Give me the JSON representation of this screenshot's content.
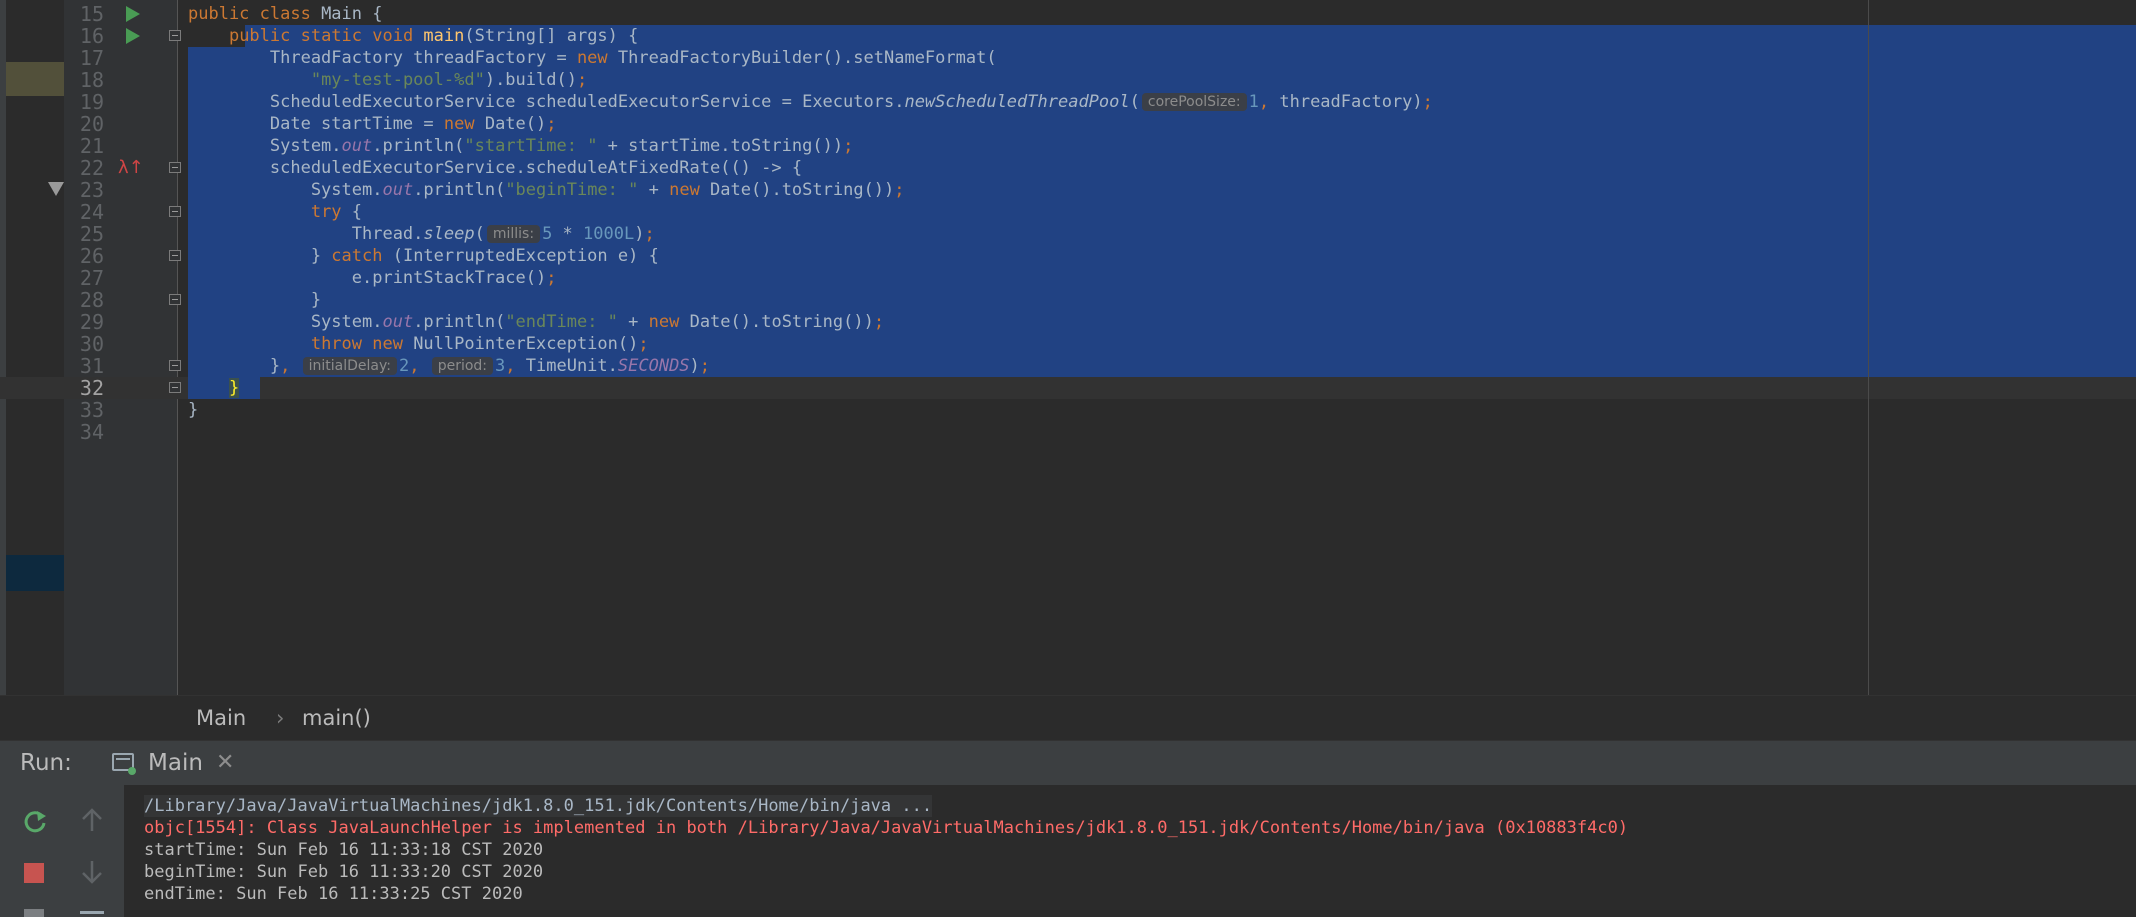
{
  "editor": {
    "lines": [
      {
        "num": "15",
        "current": false,
        "run": true,
        "fold": false,
        "override": false,
        "selection": null,
        "tokens": [
          {
            "t": "public class ",
            "c": "kw"
          },
          {
            "t": "Main {"
          }
        ]
      },
      {
        "num": "16",
        "current": false,
        "run": true,
        "fold": true,
        "override": false,
        "selection": "from-indent",
        "tokens": [
          {
            "t": "    "
          },
          {
            "t": "public static void ",
            "c": "kw"
          },
          {
            "t": "main",
            "c": "fn"
          },
          {
            "t": "(String[] args) {"
          }
        ]
      },
      {
        "num": "17",
        "current": false,
        "run": false,
        "fold": false,
        "override": false,
        "selection": "full",
        "tokens": [
          {
            "t": "        ThreadFactory threadFactory = "
          },
          {
            "t": "new ",
            "c": "kw"
          },
          {
            "t": "ThreadFactoryBuilder().setNameFormat("
          }
        ]
      },
      {
        "num": "18",
        "current": false,
        "run": false,
        "fold": false,
        "override": false,
        "selection": "full",
        "tokens": [
          {
            "t": "            "
          },
          {
            "t": "\"my-test-pool-%d\"",
            "c": "str"
          },
          {
            "t": ").build()"
          },
          {
            "t": ";",
            "c": "kw"
          }
        ]
      },
      {
        "num": "19",
        "current": false,
        "run": false,
        "fold": false,
        "override": false,
        "selection": "full",
        "tokens": [
          {
            "t": "        ScheduledExecutorService scheduledExecutorService = Executors."
          },
          {
            "t": "newScheduledThreadPool",
            "c": "ital"
          },
          {
            "t": "("
          },
          {
            "t": "corePoolSize:",
            "c": "hint"
          },
          {
            "t": "1",
            "c": "num"
          },
          {
            "t": ", ",
            "c": "kw"
          },
          {
            "t": "threadFactory)"
          },
          {
            "t": ";",
            "c": "kw"
          }
        ]
      },
      {
        "num": "20",
        "current": false,
        "run": false,
        "fold": false,
        "override": false,
        "selection": "full",
        "tokens": [
          {
            "t": "        Date startTime = "
          },
          {
            "t": "new ",
            "c": "kw"
          },
          {
            "t": "Date()"
          },
          {
            "t": ";",
            "c": "kw"
          }
        ]
      },
      {
        "num": "21",
        "current": false,
        "run": false,
        "fold": false,
        "override": false,
        "selection": "full",
        "tokens": [
          {
            "t": "        System."
          },
          {
            "t": "out",
            "c": "field"
          },
          {
            "t": ".println("
          },
          {
            "t": "\"startTime: \"",
            "c": "str"
          },
          {
            "t": " + startTime.toString())"
          },
          {
            "t": ";",
            "c": "kw"
          }
        ]
      },
      {
        "num": "22",
        "current": false,
        "run": false,
        "fold": true,
        "override": true,
        "selection": "full",
        "tokens": [
          {
            "t": "        scheduledExecutorService.scheduleAtFixedRate(() -> {"
          }
        ]
      },
      {
        "num": "23",
        "current": false,
        "run": false,
        "fold": false,
        "override": false,
        "selection": "full",
        "tokens": [
          {
            "t": "            System."
          },
          {
            "t": "out",
            "c": "field"
          },
          {
            "t": ".println("
          },
          {
            "t": "\"beginTime: \"",
            "c": "str"
          },
          {
            "t": " + "
          },
          {
            "t": "new ",
            "c": "kw"
          },
          {
            "t": "Date().toString())"
          },
          {
            "t": ";",
            "c": "kw"
          }
        ]
      },
      {
        "num": "24",
        "current": false,
        "run": false,
        "fold": true,
        "override": false,
        "selection": "full",
        "tokens": [
          {
            "t": "            "
          },
          {
            "t": "try ",
            "c": "kw"
          },
          {
            "t": "{"
          }
        ]
      },
      {
        "num": "25",
        "current": false,
        "run": false,
        "fold": false,
        "override": false,
        "selection": "full",
        "tokens": [
          {
            "t": "                Thread."
          },
          {
            "t": "sleep",
            "c": "ital"
          },
          {
            "t": "("
          },
          {
            "t": "millis:",
            "c": "hint"
          },
          {
            "t": "5 ",
            "c": "num"
          },
          {
            "t": "* "
          },
          {
            "t": "1000L",
            "c": "num"
          },
          {
            "t": ")"
          },
          {
            "t": ";",
            "c": "kw"
          }
        ]
      },
      {
        "num": "26",
        "current": false,
        "run": false,
        "fold": true,
        "override": false,
        "selection": "full",
        "tokens": [
          {
            "t": "            } "
          },
          {
            "t": "catch ",
            "c": "kw"
          },
          {
            "t": "(InterruptedException e) {"
          }
        ]
      },
      {
        "num": "27",
        "current": false,
        "run": false,
        "fold": false,
        "override": false,
        "selection": "full",
        "tokens": [
          {
            "t": "                e.printStackTrace()"
          },
          {
            "t": ";",
            "c": "kw"
          }
        ]
      },
      {
        "num": "28",
        "current": false,
        "run": false,
        "fold": true,
        "override": false,
        "selection": "full",
        "tokens": [
          {
            "t": "            }"
          }
        ]
      },
      {
        "num": "29",
        "current": false,
        "run": false,
        "fold": false,
        "override": false,
        "selection": "full",
        "tokens": [
          {
            "t": "            System."
          },
          {
            "t": "out",
            "c": "field"
          },
          {
            "t": ".println("
          },
          {
            "t": "\"endTime: \"",
            "c": "str"
          },
          {
            "t": " + "
          },
          {
            "t": "new ",
            "c": "kw"
          },
          {
            "t": "Date().toString())"
          },
          {
            "t": ";",
            "c": "kw"
          }
        ]
      },
      {
        "num": "30",
        "current": false,
        "run": false,
        "fold": false,
        "override": false,
        "selection": "full",
        "tokens": [
          {
            "t": "            "
          },
          {
            "t": "throw new ",
            "c": "kw"
          },
          {
            "t": "NullPointerException()"
          },
          {
            "t": ";",
            "c": "kw"
          }
        ]
      },
      {
        "num": "31",
        "current": false,
        "run": false,
        "fold": true,
        "override": false,
        "selection": "full",
        "tokens": [
          {
            "t": "        }"
          },
          {
            "t": ", ",
            "c": "kw"
          },
          {
            "t": "initialDelay:",
            "c": "hint"
          },
          {
            "t": "2",
            "c": "num"
          },
          {
            "t": ", ",
            "c": "kw"
          },
          {
            "t": "period:",
            "c": "hint"
          },
          {
            "t": "3",
            "c": "num"
          },
          {
            "t": ", ",
            "c": "kw"
          },
          {
            "t": "TimeUnit."
          },
          {
            "t": "SECONDS",
            "c": "field"
          },
          {
            "t": ")"
          },
          {
            "t": ";",
            "c": "kw"
          }
        ]
      },
      {
        "num": "32",
        "current": true,
        "run": false,
        "fold": true,
        "override": false,
        "selection": "partial",
        "tokens": [
          {
            "t": "    "
          },
          {
            "t": "}",
            "c": "brace"
          }
        ]
      },
      {
        "num": "33",
        "current": false,
        "run": false,
        "fold": false,
        "override": false,
        "selection": null,
        "tokens": [
          {
            "t": "}"
          }
        ]
      },
      {
        "num": "34",
        "current": false,
        "run": false,
        "fold": false,
        "override": false,
        "selection": null,
        "tokens": []
      }
    ]
  },
  "breadcrumbs": {
    "class_name": "Main",
    "separator": "›",
    "method": "main()"
  },
  "run_panel": {
    "label": "Run:",
    "tab_label": "Main",
    "tab_close": "✕",
    "console": [
      {
        "text": "/Library/Java/JavaVirtualMachines/jdk1.8.0_151.jdk/Contents/Home/bin/java ...",
        "kind": "cmd"
      },
      {
        "text": "objc[1554]: Class JavaLaunchHelper is implemented in both /Library/Java/JavaVirtualMachines/jdk1.8.0_151.jdk/Contents/Home/bin/java (0x10883f4c0)",
        "kind": "err"
      },
      {
        "text": "startTime: Sun Feb 16 11:33:18 CST 2020",
        "kind": "out"
      },
      {
        "text": "beginTime: Sun Feb 16 11:33:20 CST 2020",
        "kind": "out"
      },
      {
        "text": "endTime: Sun Feb 16 11:33:25 CST 2020",
        "kind": "out"
      }
    ],
    "toolbar_icons": [
      "rerun-icon",
      "up-arrow-icon",
      "stop-icon",
      "down-arrow-icon",
      "settings-icon"
    ]
  },
  "colors": {
    "editor_bg": "#2b2b2b",
    "selection": "#214283",
    "keyword": "#cc7832",
    "string": "#6a8759",
    "number": "#6897bb",
    "field": "#9876aa",
    "method_decl": "#ffc66d",
    "error_text": "#ff6b68",
    "run_green": "#499c54",
    "stop_red": "#c75450"
  }
}
